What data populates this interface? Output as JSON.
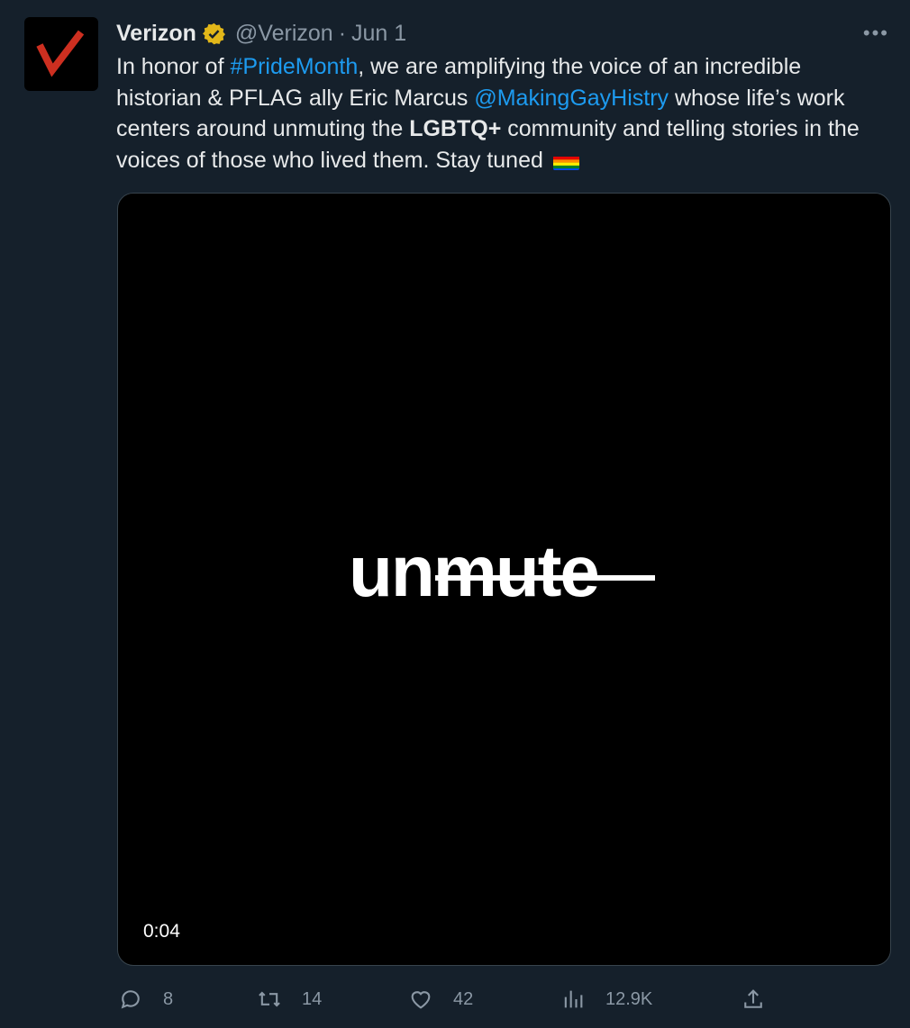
{
  "tweet": {
    "display_name": "Verizon",
    "handle": "@Verizon",
    "separator": "·",
    "date": "Jun 1",
    "more": "•••",
    "text": {
      "p1": "In honor of ",
      "hashtag": "#PrideMonth",
      "p2": ", we are amplifying the voice of an incredible historian & PFLAG ally Eric Marcus ",
      "mention": "@MakingGayHistry",
      "p3": " whose life’s work centers around unmuting the ",
      "bold": "LGBTQ+",
      "p4": " community and telling stories in the voices of those who lived them. Stay tuned"
    },
    "flag_icon": "rainbow-flag-icon"
  },
  "media": {
    "title_prefix": "un",
    "title_struck": "mute",
    "timestamp": "0:04"
  },
  "actions": {
    "replies": "8",
    "retweets": "14",
    "likes": "42",
    "views": "12.9K"
  },
  "colors": {
    "background": "#15202b",
    "link": "#1d9bf0",
    "verizon_red": "#cd2f20",
    "verified_gold": "#e2b719"
  }
}
